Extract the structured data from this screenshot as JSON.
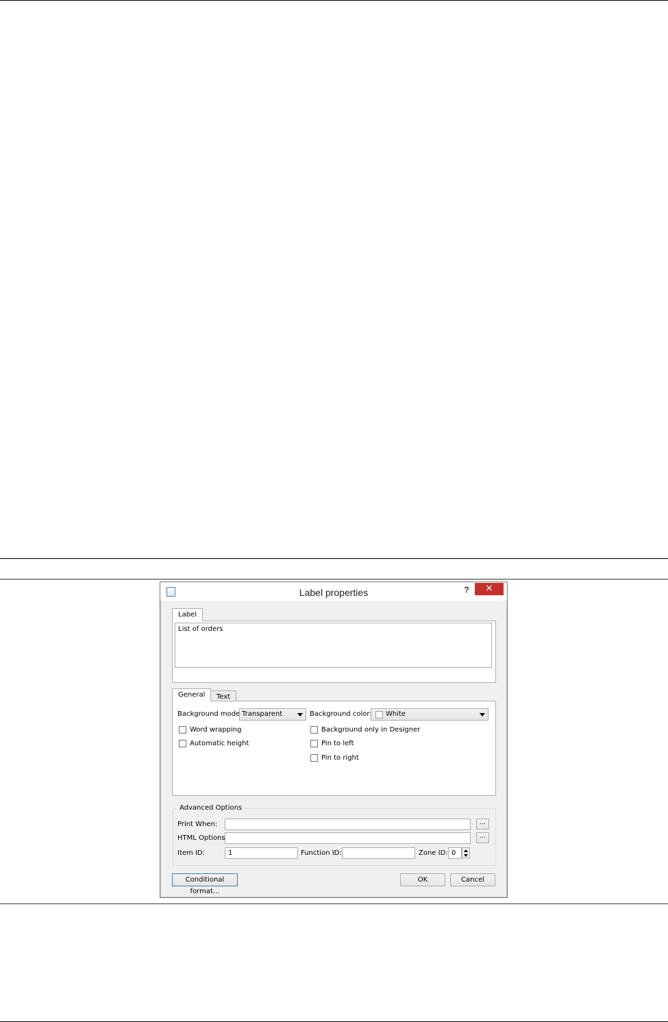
{
  "dialog": {
    "title": "Label properties",
    "icon": "document-icon",
    "help_label": "?",
    "close_label": "✕"
  },
  "label_section": {
    "tab_label": "Label",
    "text_value": "List of orders"
  },
  "tabs": [
    {
      "label": "General",
      "active": true
    },
    {
      "label": "Text",
      "active": false
    }
  ],
  "general": {
    "background_mode_label": "Background mode:",
    "background_mode_value": "Transparent",
    "background_color_label": "Background color:",
    "background_color_value": "White",
    "word_wrapping": "Word wrapping",
    "automatic_height": "Automatic height",
    "background_only_designer": "Background only in Designer",
    "pin_to_left": "Pin to left",
    "pin_to_right": "Pin to right"
  },
  "advanced": {
    "title": "Advanced Options",
    "print_when_label": "Print When:",
    "print_when_value": "",
    "html_options_label": "HTML Options:",
    "html_options_value": "",
    "browse_label": "...",
    "item_id_label": "Item ID:",
    "item_id_value": "1",
    "function_id_label": "Function ID:",
    "function_id_value": "",
    "zone_id_label": "Zone ID:",
    "zone_id_value": "0"
  },
  "buttons": {
    "conditional_format": "Conditional format...",
    "ok": "OK",
    "cancel": "Cancel"
  },
  "colors": {
    "close_button": "#c7302a",
    "dialog_background": "#f0f0f0",
    "focus_border": "#3c7fb1"
  }
}
